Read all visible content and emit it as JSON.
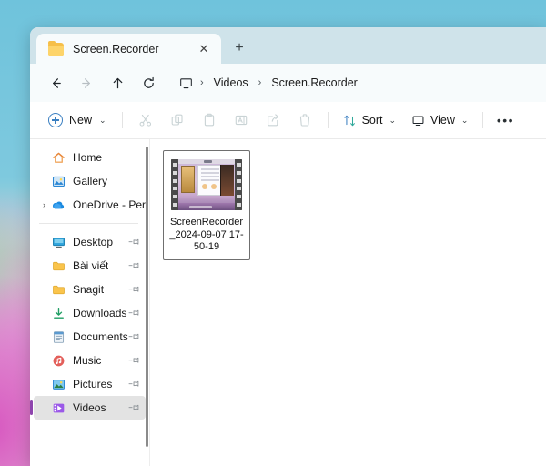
{
  "window": {
    "tab": {
      "title": "Screen.Recorder",
      "close_label": "✕",
      "new_tab_label": "+",
      "folder_icon": "folder-icon"
    },
    "address": {
      "back_label": "Back",
      "forward_label": "Forward",
      "up_label": "Up",
      "refresh_label": "Refresh",
      "pc_icon": "this-pc-icon",
      "crumbs": [
        "Videos",
        "Screen.Recorder"
      ],
      "separator": "›"
    },
    "toolbar": {
      "new_label": "New",
      "new_chevron": "⌄",
      "cut_label": "Cut",
      "copy_label": "Copy",
      "paste_label": "Paste",
      "rename_label": "Rename",
      "share_label": "Share",
      "delete_label": "Delete",
      "sort_label": "Sort",
      "sort_chevron": "⌄",
      "view_label": "View",
      "view_chevron": "⌄",
      "more_label": "•••"
    },
    "navpane": {
      "groups": [
        {
          "items": [
            {
              "label": "Home",
              "icon": "home-icon",
              "pinned": false,
              "expandable": false,
              "selected": false
            },
            {
              "label": "Gallery",
              "icon": "gallery-icon",
              "pinned": false,
              "expandable": false,
              "selected": false
            },
            {
              "label": "OneDrive - Pers",
              "icon": "onedrive-icon",
              "pinned": false,
              "expandable": true,
              "selected": false
            }
          ]
        },
        {
          "items": [
            {
              "label": "Desktop",
              "icon": "desktop-icon",
              "pinned": true,
              "expandable": false,
              "selected": false
            },
            {
              "label": "Bài viết",
              "icon": "folder-icon",
              "pinned": true,
              "expandable": false,
              "selected": false
            },
            {
              "label": "Snagit",
              "icon": "folder-icon",
              "pinned": true,
              "expandable": false,
              "selected": false
            },
            {
              "label": "Downloads",
              "icon": "downloads-icon",
              "pinned": true,
              "expandable": false,
              "selected": false
            },
            {
              "label": "Documents",
              "icon": "documents-icon",
              "pinned": true,
              "expandable": false,
              "selected": false
            },
            {
              "label": "Music",
              "icon": "music-icon",
              "pinned": true,
              "expandable": false,
              "selected": false
            },
            {
              "label": "Pictures",
              "icon": "pictures-icon",
              "pinned": true,
              "expandable": false,
              "selected": false
            },
            {
              "label": "Videos",
              "icon": "videos-icon",
              "pinned": true,
              "expandable": false,
              "selected": true
            }
          ]
        }
      ],
      "expander_glyph": "›",
      "pin_glyph": "📌"
    },
    "content": {
      "files": [
        {
          "name": "ScreenRecorder_2024-09-07 17-50-19",
          "thumbnail": "video-filmstrip-thumbnail",
          "selected": true
        }
      ]
    }
  },
  "colors": {
    "tabstrip": "#cfe3ea",
    "addressbar": "#f7fbfc",
    "accent": "#3a7fc1",
    "selection_bar": "#8e44ad",
    "nav_selected_bg": "#e3e3e3"
  }
}
